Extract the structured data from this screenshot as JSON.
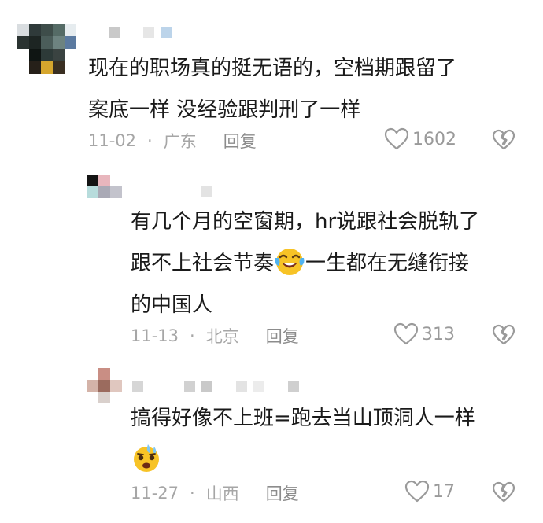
{
  "comments": [
    {
      "text_lines": [
        "现在的职场真的挺无语的，空档期跟留了",
        "案底一样 没经验跟判刑了一样"
      ],
      "date": "11-02",
      "location": "广东",
      "reply_label": "回复",
      "likes": "1602"
    }
  ],
  "replies": [
    {
      "text_line1": "有几个月的空窗期，hr说跟社会脱轨了",
      "text_line2_before": "跟不上社会节奏",
      "text_line2_after": "一生都在无缝衔接",
      "text_line3": "的中国人",
      "emoji": "crying-laughing-emoji",
      "date": "11-13",
      "location": "北京",
      "reply_label": "回复",
      "likes": "313"
    },
    {
      "text_line1": "搞得好像不上班=跑去当山顶洞人一样",
      "emoji": "sweating-emoji",
      "date": "11-27",
      "location": "山西",
      "reply_label": "回复",
      "likes": "17"
    }
  ],
  "colors": {
    "text": "#1a1a1a",
    "meta": "#a6a6a6",
    "icon": "#9a9a9a",
    "emoji_yellow": "#f7c326"
  },
  "icons": [
    "heart-outline-icon",
    "broken-heart-icon"
  ]
}
